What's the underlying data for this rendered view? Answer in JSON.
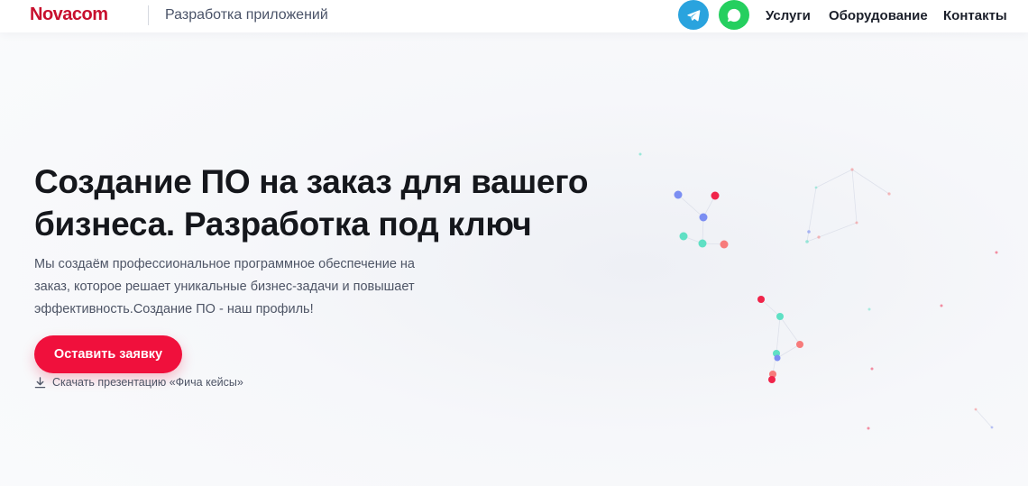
{
  "header": {
    "logo": "Novacom",
    "tagline": "Разработка приложений",
    "social": [
      {
        "name": "telegram-icon",
        "color": "#2aa3de"
      },
      {
        "name": "whatsapp-icon",
        "color": "#25cf5f"
      }
    ],
    "nav": [
      "Услуги",
      "Оборудование",
      "Контакты"
    ]
  },
  "hero": {
    "title_line1": "Создание ПО на заказ для вашего",
    "title_line2": "бизнеса. Разработка под ключ",
    "description_line1": "Мы создаём профессиональное программное обеспечение на",
    "description_line2": "заказ, которое решает уникальные бизнес-задачи и повышает",
    "description_line3": "эффективность.Создание ПО - наш профиль!",
    "cta_label": "Оставить заявку",
    "download_label": "Скачать презентацию «Фича кейсы»"
  },
  "colors": {
    "brand": "#c8102e",
    "cta": "#f0103c",
    "node_red": "#f0244a",
    "node_blue": "#7b8ef2",
    "node_teal": "#5fe0c4",
    "node_salmon": "#f77b7b"
  }
}
